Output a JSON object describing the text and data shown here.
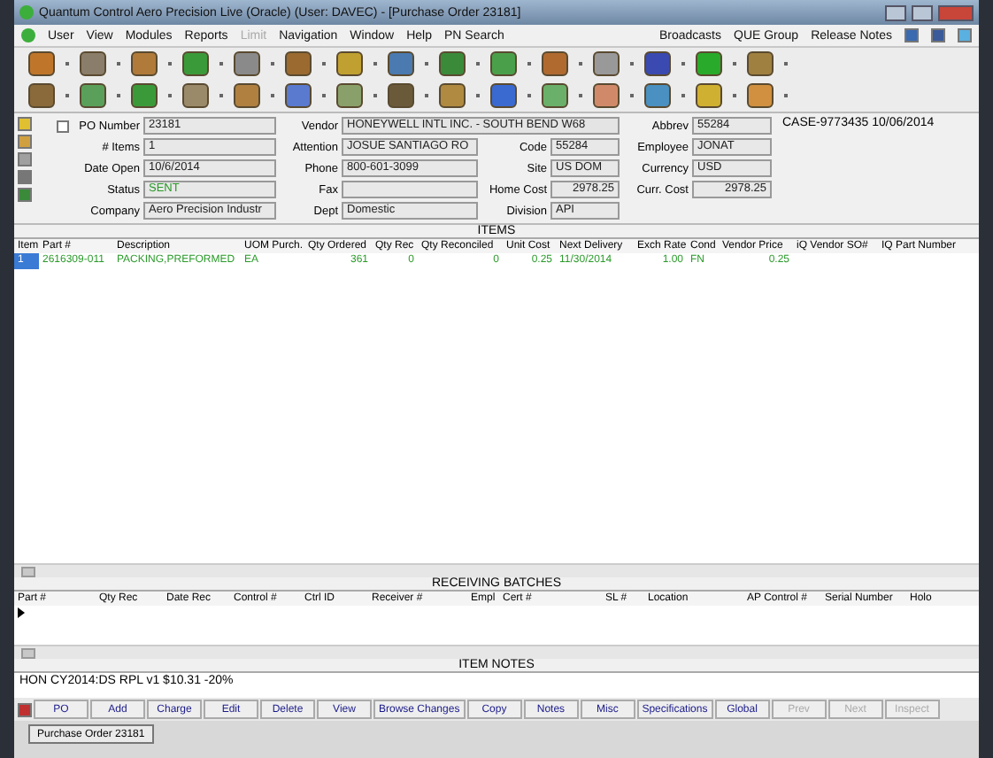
{
  "window": {
    "title": "Quantum Control Aero Precision Live (Oracle) (User: DAVEC) - [Purchase Order 23181]"
  },
  "menu": [
    {
      "label": "User",
      "disabled": false
    },
    {
      "label": "View",
      "disabled": false
    },
    {
      "label": "Modules",
      "disabled": false
    },
    {
      "label": "Reports",
      "disabled": false
    },
    {
      "label": "Limit",
      "disabled": true
    },
    {
      "label": "Navigation",
      "disabled": false
    },
    {
      "label": "Window",
      "disabled": false
    },
    {
      "label": "Help",
      "disabled": false
    }
  ],
  "pn_search": "PN Search",
  "menu_right": [
    "Broadcasts",
    "QUE Group",
    "Release Notes"
  ],
  "header": {
    "rows": [
      [
        {
          "label": "PO Number",
          "value": "23181",
          "kind": "text",
          "checked": false
        },
        {
          "label": "Vendor",
          "value": "HONEYWELL INTL INC. - SOUTH BEND W68",
          "kind": "text"
        },
        null,
        {
          "label": "Abbrev",
          "value": "55284",
          "kind": "text"
        }
      ],
      [
        {
          "label": "# Items",
          "value": "1",
          "kind": "text"
        },
        {
          "label": "Attention",
          "value": "JOSUE SANTIAGO RO",
          "kind": "text"
        },
        {
          "label": "Code",
          "value": "55284",
          "kind": "text"
        },
        {
          "label": "Employee",
          "value": "JONAT",
          "kind": "text"
        }
      ],
      [
        {
          "label": "Date Open",
          "value": "10/6/2014",
          "kind": "text"
        },
        {
          "label": "Phone",
          "value": "800-601-3099",
          "kind": "text"
        },
        {
          "label": "Site",
          "value": "US DOM",
          "kind": "text"
        },
        {
          "label": "Currency",
          "value": "USD",
          "kind": "text"
        }
      ],
      [
        {
          "label": "Status",
          "value": "SENT",
          "kind": "status"
        },
        {
          "label": "Fax",
          "kind": "text"
        },
        {
          "label": "Home Cost",
          "value": "2978.25",
          "kind": "amount"
        },
        {
          "label": "Curr. Cost",
          "value": "2978.25",
          "kind": "amount"
        }
      ],
      [
        {
          "label": "Company",
          "value": "Aero Precision Industr",
          "kind": "text"
        },
        {
          "label": "Dept",
          "value": "Domestic",
          "kind": "text"
        },
        {
          "label": "Division",
          "value": "API",
          "kind": "text"
        }
      ]
    ],
    "note": "CASE-9773435 10/06/2014"
  },
  "items": {
    "title": "ITEMS",
    "columns": [
      "Item",
      "Part #",
      "Description",
      "UOM Purch.",
      "Qty Ordered",
      "Qty Rec",
      "Qty Reconciled",
      "Unit Cost",
      "Next Delivery",
      "Exch Rate",
      "Cond",
      "Vendor Price",
      "iQ Vendor SO#",
      "IQ Part Number"
    ],
    "rows": [
      {
        "selected": true,
        "cells": [
          "1",
          "2616309-011",
          "PACKING,PREFORMED",
          "EA",
          "361",
          "0",
          "0",
          "0.25",
          "11/30/2014",
          "1.00",
          "FN",
          "0.25",
          null,
          null
        ]
      }
    ]
  },
  "receiving": {
    "title": "RECEIVING BATCHES",
    "columns": [
      "Part #",
      "Qty Rec",
      "Date Rec",
      "Control #",
      "Ctrl ID",
      "Receiver #",
      "Empl",
      "Cert #",
      "SL #",
      "Location",
      "AP Control #",
      "Serial Number",
      "Holo"
    ]
  },
  "notes": {
    "title": "ITEM NOTES",
    "text": "HON CY2014:DS RPL v1 $10.31 -20%"
  },
  "buttons": [
    {
      "label": "PO",
      "disabled": false
    },
    {
      "label": "Add",
      "disabled": false
    },
    {
      "label": "Charge",
      "disabled": false
    },
    {
      "label": "Edit",
      "disabled": false
    },
    {
      "label": "Delete",
      "disabled": false
    },
    {
      "label": "View",
      "disabled": false
    },
    {
      "label": "Browse Changes",
      "disabled": false
    },
    {
      "label": "Copy",
      "disabled": false
    },
    {
      "label": "Notes",
      "disabled": false
    },
    {
      "label": "Misc",
      "disabled": false
    },
    {
      "label": "Specifications",
      "disabled": false
    },
    {
      "label": "Global",
      "disabled": false
    },
    {
      "label": "Prev",
      "disabled": true
    },
    {
      "label": "Next",
      "disabled": true
    },
    {
      "label": "Inspect",
      "disabled": true
    }
  ],
  "taskbar": [
    {
      "label": "Purchase Order 23181",
      "selected": true
    }
  ]
}
